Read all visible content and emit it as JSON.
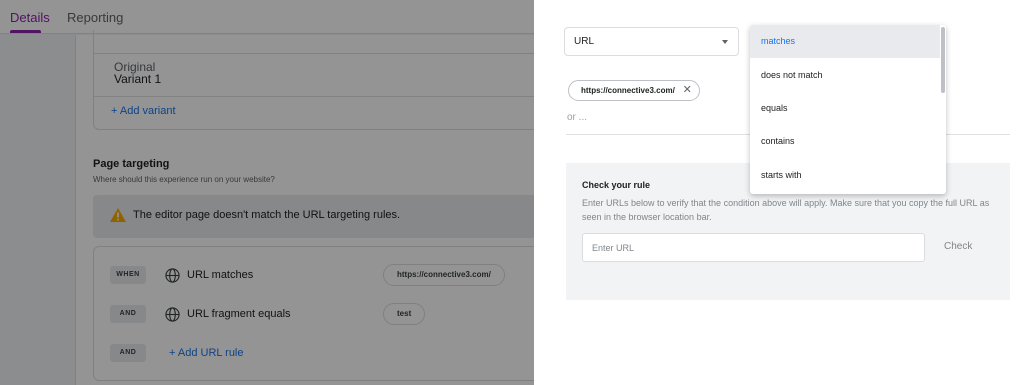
{
  "tabs": [
    {
      "label": "Details",
      "active": true
    },
    {
      "label": "Reporting",
      "active": false
    }
  ],
  "variants": {
    "items": [
      "Original",
      "Variant 1"
    ],
    "add_label": "+ Add variant"
  },
  "page_targeting": {
    "title": "Page targeting",
    "subtitle": "Where should this experience run on your website?",
    "warning": "The editor page doesn't match the URL targeting rules."
  },
  "rules": [
    {
      "op": "WHEN",
      "text": "URL matches",
      "value": "https://connective3.com/"
    },
    {
      "op": "AND",
      "text": "URL fragment equals",
      "value": "test"
    }
  ],
  "add_rule": {
    "op": "AND",
    "label": "+ Add URL rule"
  },
  "panel": {
    "select_value": "URL",
    "chip_value": "https://connective3.com/",
    "or_text": "or ...",
    "check_title": "Check your rule",
    "check_desc": "Enter URLs below to verify that the condition above will apply. Make sure that you copy the full URL as seen in the browser location bar.",
    "input_placeholder": "Enter URL",
    "check_button": "Check"
  },
  "dropdown": {
    "selected": "matches",
    "options": [
      "matches",
      "does not match",
      "equals",
      "contains",
      "starts with"
    ]
  },
  "colors": {
    "accent": "#8e24aa",
    "link": "#1a73e8",
    "warning": "#f9ab00"
  }
}
